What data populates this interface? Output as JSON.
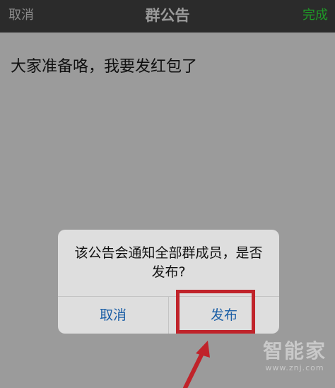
{
  "navbar": {
    "cancel_label": "取消",
    "title": "群公告",
    "done_label": "完成"
  },
  "content": {
    "announcement_text": "大家准备咯，我要发红包了"
  },
  "dialog": {
    "message": "该公告会通知全部群成员，是否发布?",
    "cancel_label": "取消",
    "publish_label": "发布"
  },
  "annotation": {
    "highlight_color": "#c0232a"
  },
  "watermark": {
    "logo": "智能家",
    "url": "www.znj.com"
  },
  "colors": {
    "navbar_bg": "#2b2b2b",
    "done_green": "#1f9a27",
    "dialog_button_blue": "#1c5fa6",
    "overlay_gray": "#9b9b9b"
  }
}
